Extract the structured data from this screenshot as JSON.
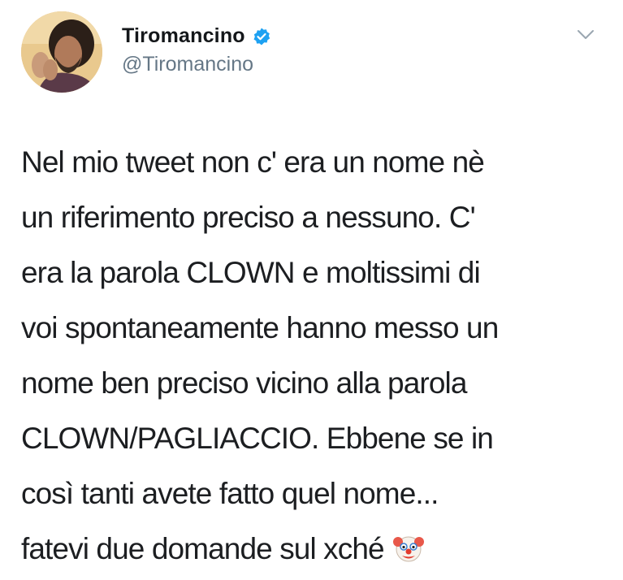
{
  "user": {
    "display_name": "Tiromancino",
    "handle": "@Tiromancino",
    "avatar_icon": "profile-photo",
    "verified_icon": "verified-badge-icon",
    "verified_color": "#1da1f2"
  },
  "menu_icon": "chevron-down-icon",
  "tweet": {
    "lines": [
      "Nel mio tweet non c' era un nome nè",
      "un riferimento preciso a nessuno. C'",
      "era la parola CLOWN e moltissimi di",
      "voi spontaneamente hanno messo un",
      "nome ben preciso vicino alla parola",
      "CLOWN/PAGLIACCIO. Ebbene se in",
      "così tanti avete fatto quel nome...",
      "fatevi due domande sul xché"
    ],
    "emoji_icon": "clown-face-icon"
  },
  "colors": {
    "name_text": "#14171a",
    "handle_text": "#657786",
    "body_text": "#1c1e21"
  }
}
